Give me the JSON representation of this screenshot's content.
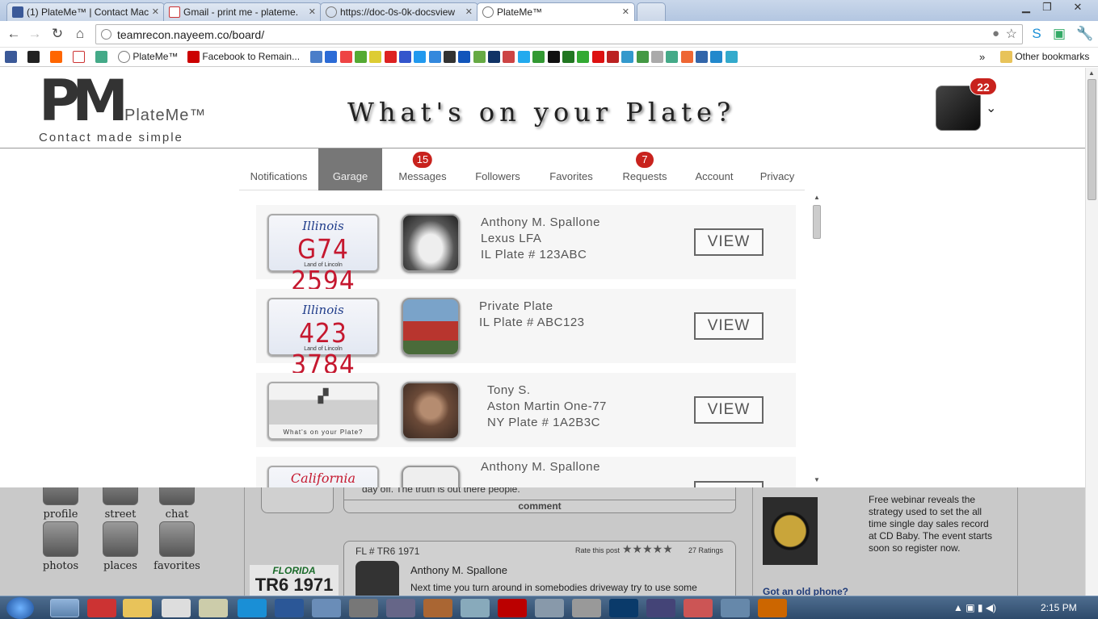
{
  "browser": {
    "tabs": [
      {
        "label": "(1) PlateMe™ | Contact Mac",
        "active": false
      },
      {
        "label": "Gmail - print me - plateme.",
        "active": false
      },
      {
        "label": "https://doc-0s-0k-docsview",
        "active": false
      },
      {
        "label": "PlateMe™",
        "active": true
      }
    ],
    "url": "teamrecon.nayeem.co/board/",
    "bookmarks": {
      "plateme": "PlateMe™",
      "facebook_remain": "Facebook to Remain...",
      "other": "Other bookmarks"
    }
  },
  "site": {
    "logo_mark": "PM",
    "logo_name": "PlateMe™",
    "logo_slogan": "Contact made simple",
    "tagline": "What's on your Plate?",
    "avatar_badge": "22"
  },
  "nav": {
    "items": [
      {
        "label": "Notifications",
        "badge": ""
      },
      {
        "label": "Garage",
        "badge": ""
      },
      {
        "label": "Messages",
        "badge": "15"
      },
      {
        "label": "Followers",
        "badge": ""
      },
      {
        "label": "Favorites",
        "badge": ""
      },
      {
        "label": "Requests",
        "badge": "7"
      },
      {
        "label": "Account",
        "badge": ""
      },
      {
        "label": "Privacy",
        "badge": ""
      }
    ],
    "active": "Garage"
  },
  "plates": [
    {
      "state": "Illinois",
      "number": "G74 2594",
      "foot": "Land of Lincoln",
      "line1": "Anthony M. Spallone",
      "line2": "Lexus LFA",
      "line3": "IL Plate # 123ABC",
      "view": "VIEW"
    },
    {
      "state": "Illinois",
      "number": "423 3784",
      "foot": "Land of Lincoln",
      "line1": "Private Plate",
      "line2": "IL Plate # ABC123",
      "line3": "",
      "view": "VIEW"
    },
    {
      "state": "",
      "number": "",
      "foot": "What's on your Plate?",
      "line1": "Tony S.",
      "line2": "Aston Martin One-77",
      "line3": "NY Plate # 1A2B3C",
      "view": "VIEW"
    },
    {
      "state": "California",
      "number": "",
      "foot": "",
      "line1": "Anthony M. Spallone",
      "line2": "",
      "line3": "",
      "view": ""
    }
  ],
  "background_page": {
    "icons": [
      "profile",
      "street",
      "chat",
      "photos",
      "places",
      "favorites"
    ],
    "feed_snippet": "day off. The truth is out there people.",
    "comment_label": "comment",
    "post_header": "FL # TR6 1971",
    "rate_label": "Rate this post",
    "ratings": "27 Ratings",
    "post_author": "Anthony M. Spallone",
    "post_text": "Next time you turn around in somebodies driveway try to use some",
    "ad_text": "Free webinar reveals the strategy used to set the all time single day sales record at CD Baby. The event starts soon so register now.",
    "ad_link": "Got an old phone?",
    "plate_florida": "FLORIDA",
    "plate_florida_num": "TR6 1971"
  },
  "taskbar": {
    "clock": "2:15 PM"
  }
}
